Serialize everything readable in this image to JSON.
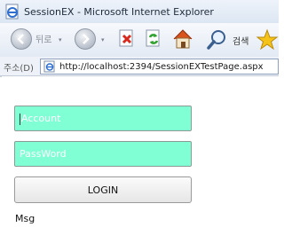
{
  "window": {
    "title": "SessionEX - Microsoft Internet Explorer"
  },
  "toolbar": {
    "back_label": "뒤로",
    "search_label": "검색",
    "icons": [
      "back-icon",
      "forward-icon",
      "stop-icon",
      "refresh-icon",
      "home-icon",
      "search-icon",
      "favorites-icon"
    ]
  },
  "address_bar": {
    "label": "주소(D)",
    "url": "http://localhost:2394/SessionEXTestPage.aspx"
  },
  "form": {
    "account_value": "Account",
    "password_value": "PassWord",
    "login_label": "LOGIN",
    "field_color": "#80ffd4"
  },
  "status": {
    "msg": "Msg"
  }
}
